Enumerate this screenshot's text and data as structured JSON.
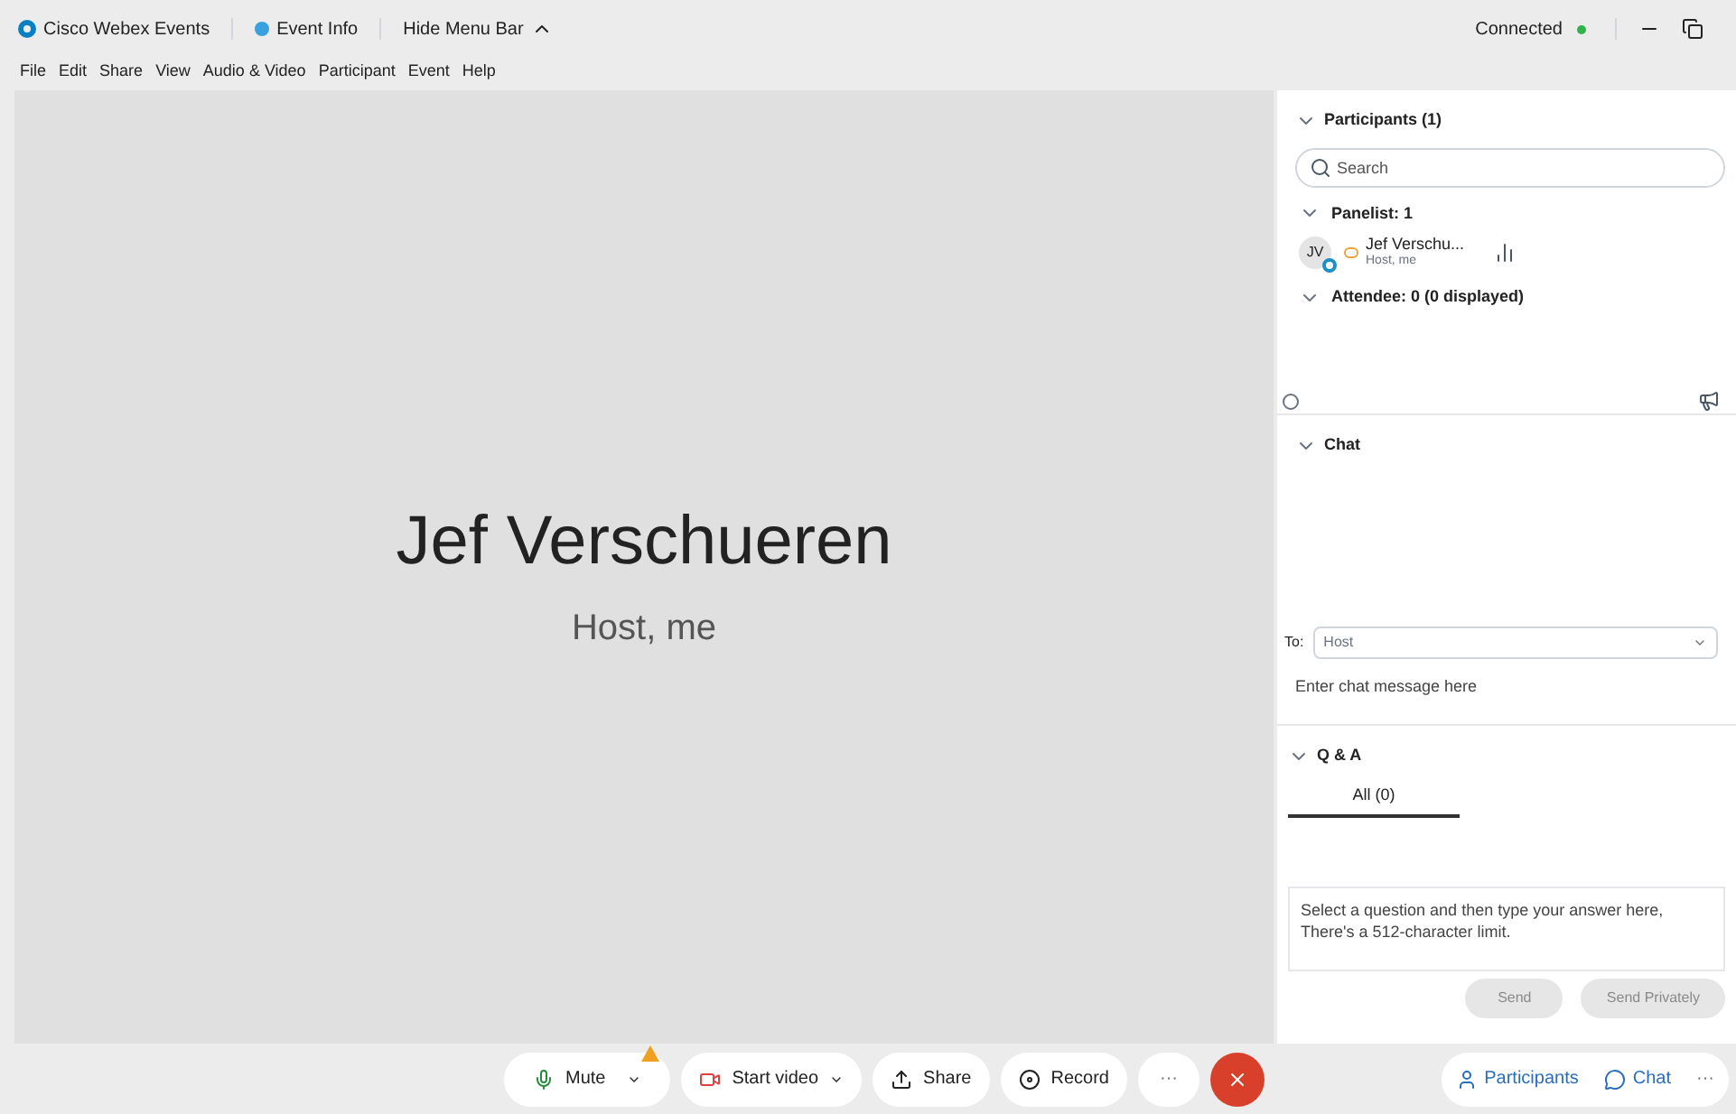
{
  "title_bar": {
    "app_name": "Cisco Webex Events",
    "event_info": "Event Info",
    "hide_menu": "Hide Menu Bar",
    "status": "Connected"
  },
  "menu": [
    "File",
    "Edit",
    "Share",
    "View",
    "Audio & Video",
    "Participant",
    "Event",
    "Help"
  ],
  "stage": {
    "name": "Jef Verschueren",
    "role": "Host, me"
  },
  "participants": {
    "title": "Participants (1)",
    "expanded": true,
    "search": {
      "placeholder": "Search"
    },
    "groups": [
      {
        "label": "Panelist: 1",
        "expanded": true,
        "members": [
          {
            "initials": "JV",
            "name": "Jef Verschu...",
            "role": "Host, me"
          }
        ]
      },
      {
        "label": "Attendee: 0 (0 displayed)",
        "expanded": true
      }
    ]
  },
  "chat": {
    "title": "Chat",
    "expanded": true,
    "to_label": "To:",
    "to_value": "Host",
    "message": {
      "placeholder": "Enter chat message here"
    }
  },
  "qa": {
    "title": "Q & A",
    "expanded": true,
    "tabs": [
      {
        "label": "All (0)",
        "selected": true
      }
    ],
    "answer": {
      "placeholder": "Select a question and then type your answer here,\nThere's a 512-character limit."
    },
    "buttons": [
      {
        "label": "Send",
        "disabled": true
      },
      {
        "label": "Send Privately",
        "disabled": true
      }
    ]
  },
  "toolbar": {
    "mute": "Mute",
    "start_video": "Start video",
    "share": "Share",
    "record": "Record",
    "more": "···",
    "panels": [
      {
        "label": "Participants",
        "kind": "participants"
      },
      {
        "label": "Chat",
        "kind": "chat"
      }
    ],
    "panel_more": "···"
  }
}
